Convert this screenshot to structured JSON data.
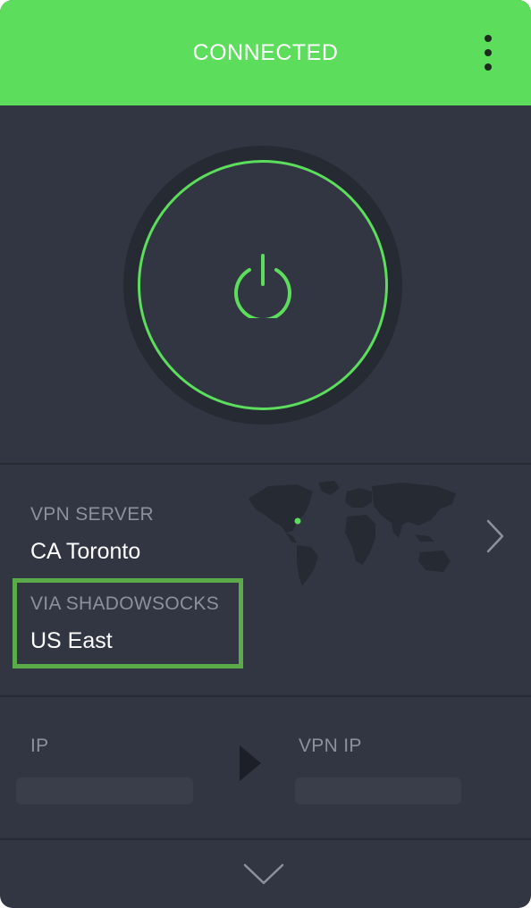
{
  "header": {
    "status": "CONNECTED",
    "menu_icon": "vertical-dots-icon",
    "color": "#5cdd5c"
  },
  "power": {
    "icon": "power-icon",
    "state": "connected",
    "ring_color": "#5cdd5c"
  },
  "server": {
    "label": "VPN SERVER",
    "value": "CA Toronto",
    "map_icon": "world-map-icon",
    "chevron_icon": "chevron-right-icon"
  },
  "via": {
    "label": "VIA SHADOWSOCKS",
    "value": "US East",
    "highlight_color": "#5bab4a"
  },
  "ip": {
    "ip_label": "IP",
    "vpn_ip_label": "VPN IP",
    "arrow_icon": "play-arrow-icon"
  },
  "footer": {
    "expand_icon": "chevron-down-icon"
  },
  "colors": {
    "background": "#323642",
    "accent": "#5cdd5c",
    "muted_text": "#8d919b"
  }
}
